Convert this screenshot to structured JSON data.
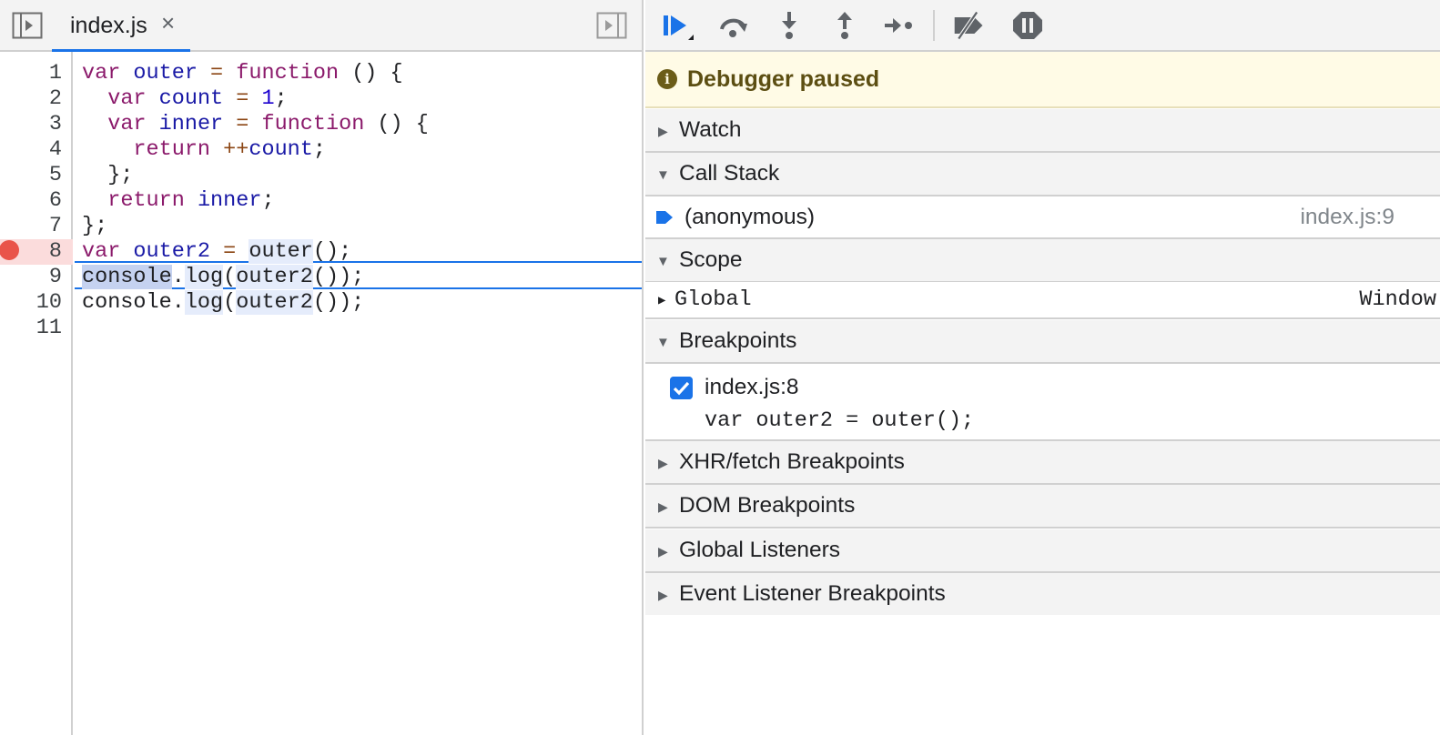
{
  "editor": {
    "tab": {
      "name": "index.js",
      "close_glyph": "×"
    },
    "icons": {
      "navigator_toggle": "show-navigator-icon",
      "debugger_toggle": "show-debugger-icon"
    },
    "line_numbers": [
      "1",
      "2",
      "3",
      "4",
      "5",
      "6",
      "7",
      "8",
      "9",
      "10",
      "11"
    ],
    "breakpoint_line": "8",
    "current_line": "9",
    "code": {
      "l1": [
        "var",
        " ",
        "outer",
        " ",
        "=",
        " ",
        "function",
        " () {"
      ],
      "l2": [
        "  ",
        "var",
        " ",
        "count",
        " ",
        "=",
        " ",
        "1",
        ";"
      ],
      "l3": [
        "  ",
        "var",
        " ",
        "inner",
        " ",
        "=",
        " ",
        "function",
        " () {"
      ],
      "l4": [
        "    ",
        "return",
        " ",
        "++",
        "count",
        ";"
      ],
      "l5": "  };",
      "l6": [
        "  ",
        "return",
        " ",
        "inner",
        ";"
      ],
      "l7": "};",
      "l8": [
        "var",
        " ",
        "outer2",
        " ",
        "=",
        " ",
        "outer",
        "();"
      ],
      "l9": [
        "console",
        ".",
        "log",
        "(",
        "outer2",
        "());"
      ],
      "l10": [
        "console",
        ".",
        "log",
        "(",
        "outer2",
        "());"
      ],
      "l11": ""
    }
  },
  "debugger": {
    "toolbar": [
      {
        "name": "resume-icon",
        "title": "Resume script execution"
      },
      {
        "name": "step-over-icon",
        "title": "Step over next function call"
      },
      {
        "name": "step-into-icon",
        "title": "Step into next function call"
      },
      {
        "name": "step-out-icon",
        "title": "Step out of current function"
      },
      {
        "name": "step-icon",
        "title": "Step"
      },
      {
        "name": "deactivate-breakpoints-icon",
        "title": "Deactivate breakpoints"
      },
      {
        "name": "pause-on-exceptions-icon",
        "title": "Pause on exceptions"
      }
    ],
    "status": "Debugger paused",
    "sections": {
      "watch": "Watch",
      "call_stack": "Call Stack",
      "scope": "Scope",
      "breakpoints": "Breakpoints",
      "xhr": "XHR/fetch Breakpoints",
      "dom": "DOM Breakpoints",
      "global_listeners": "Global Listeners",
      "event_listener": "Event Listener Breakpoints"
    },
    "call_stack": [
      {
        "function": "(anonymous)",
        "location": "index.js:9"
      }
    ],
    "scope": [
      {
        "name": "Global",
        "value": "Window"
      }
    ],
    "breakpoints": [
      {
        "file": "index.js:8",
        "source": "var outer2 = outer();",
        "checked": true
      }
    ],
    "colors": {
      "accent": "#1a73e8",
      "breakpoint": "#e9544a",
      "paused_bg": "#fffbe6"
    }
  }
}
